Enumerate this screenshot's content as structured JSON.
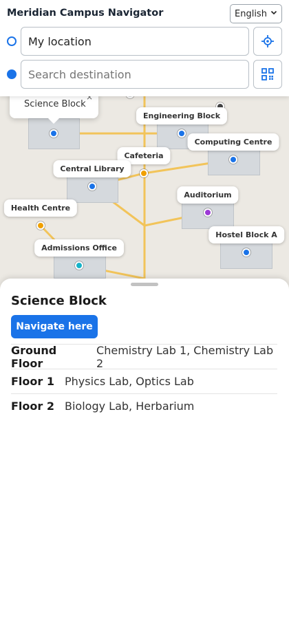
{
  "header": {
    "title": "Meridian Campus Navigator",
    "language": "English",
    "origin_value": "My location",
    "destination_placeholder": "Search destination"
  },
  "map": {
    "popup": {
      "label": "Science Block",
      "close_glyph": "×"
    },
    "locations": [
      {
        "key": "engineering",
        "label": "Engineering Block",
        "pin_color": "#1a73e8"
      },
      {
        "key": "computing",
        "label": "Computing Centre",
        "pin_color": "#1a73e8"
      },
      {
        "key": "cafeteria",
        "label": "Cafeteria",
        "pin_color": "#f0a000"
      },
      {
        "key": "library",
        "label": "Central Library",
        "pin_color": "#1a73e8"
      },
      {
        "key": "auditorium",
        "label": "Auditorium",
        "pin_color": "#9c3ad6"
      },
      {
        "key": "health",
        "label": "Health Centre",
        "pin_color": "#f0a000"
      },
      {
        "key": "hostel",
        "label": "Hostel Block A",
        "pin_color": "#1a73e8"
      },
      {
        "key": "admissions",
        "label": "Admissions Office",
        "pin_color": "#17b3c9"
      }
    ]
  },
  "sheet": {
    "title": "Science Block",
    "navigate_label": "Navigate here",
    "floors": [
      {
        "name": "Ground Floor",
        "rooms": "Chemistry Lab 1, Chemistry Lab 2"
      },
      {
        "name": "Floor 1",
        "rooms": "Physics Lab, Optics Lab"
      },
      {
        "name": "Floor 2",
        "rooms": "Biology Lab, Herbarium"
      }
    ]
  },
  "colors": {
    "accent": "#1a73e8",
    "path": "#f2c45a"
  },
  "icons": {
    "locate": "crosshair-icon",
    "scan": "qr-code-icon"
  }
}
